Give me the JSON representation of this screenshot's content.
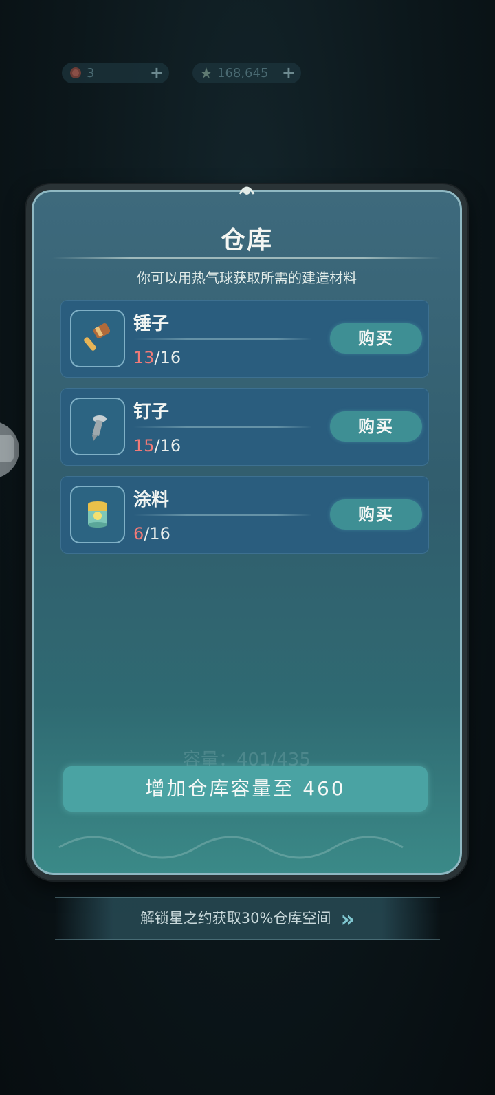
{
  "currency": {
    "lives": {
      "value": "3",
      "icon": "heart-icon",
      "plus": "+"
    },
    "stars": {
      "value": "168,645",
      "icon": "star-gem-icon",
      "plus": "+"
    }
  },
  "modal": {
    "title": "仓库",
    "subtitle": "你可以用热气球获取所需的建造材料",
    "items": [
      {
        "name": "锤子",
        "current": "13",
        "total": "/16",
        "buy_label": "购买",
        "icon": "hammer-icon"
      },
      {
        "name": "钉子",
        "current": "15",
        "total": "/16",
        "buy_label": "购买",
        "icon": "nail-icon"
      },
      {
        "name": "涂料",
        "current": "6",
        "total": "/16",
        "buy_label": "购买",
        "icon": "paint-bucket-icon"
      }
    ],
    "capacity_ghost": "容量：401/435",
    "upgrade_label": "增加仓库容量至 460"
  },
  "banner": {
    "text": "解锁星之约获取30%仓库空间",
    "arrow": "»"
  },
  "colors": {
    "accent": "#4aa3a3",
    "count_current": "#f07a78",
    "panel": "#2a5d7e"
  }
}
